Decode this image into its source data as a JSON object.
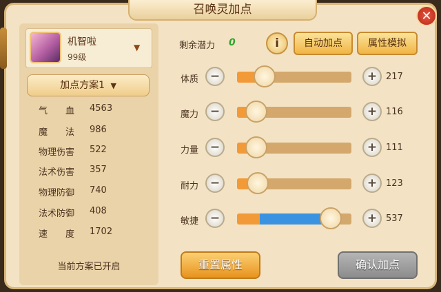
{
  "title": "召唤灵加点",
  "close_label": "✕",
  "pet": {
    "name": "机智啦",
    "level": "99级",
    "expand_icon": "chevron-down-icon"
  },
  "scheme": {
    "label": "加点方案1",
    "status": "当前方案已开启"
  },
  "stats": [
    {
      "label": "气　　血",
      "value": "4563"
    },
    {
      "label": "魔　　法",
      "value": "986"
    },
    {
      "label": "物理伤害",
      "value": "522"
    },
    {
      "label": "法术伤害",
      "value": "357"
    },
    {
      "label": "物理防御",
      "value": "740"
    },
    {
      "label": "法术防御",
      "value": "408"
    },
    {
      "label": "速　　度",
      "value": "1702"
    }
  ],
  "potential": {
    "label": "剩余潜力",
    "value": "0"
  },
  "buttons": {
    "info": "i",
    "auto_add": "自动加点",
    "simulate": "属性模拟",
    "reset": "重置属性",
    "confirm": "确认加点"
  },
  "controls": {
    "minus": "−",
    "plus": "+"
  },
  "attributes": [
    {
      "label": "体质",
      "value": "217",
      "base_fraction": 0.18,
      "total_fraction": 0.24
    },
    {
      "label": "魔力",
      "value": "116",
      "base_fraction": 0.17,
      "total_fraction": 0.17
    },
    {
      "label": "力量",
      "value": "111",
      "base_fraction": 0.17,
      "total_fraction": 0.17
    },
    {
      "label": "耐力",
      "value": "123",
      "base_fraction": 0.18,
      "total_fraction": 0.18
    },
    {
      "label": "敏捷",
      "value": "537",
      "base_fraction": 0.2,
      "total_fraction": 0.82
    }
  ],
  "colors": {
    "panel": "#f3e3c4",
    "potential_value": "#2fa52f",
    "base_fill": "#f29a38",
    "bonus_fill": "#3a92e0",
    "close": "#c8301f"
  }
}
